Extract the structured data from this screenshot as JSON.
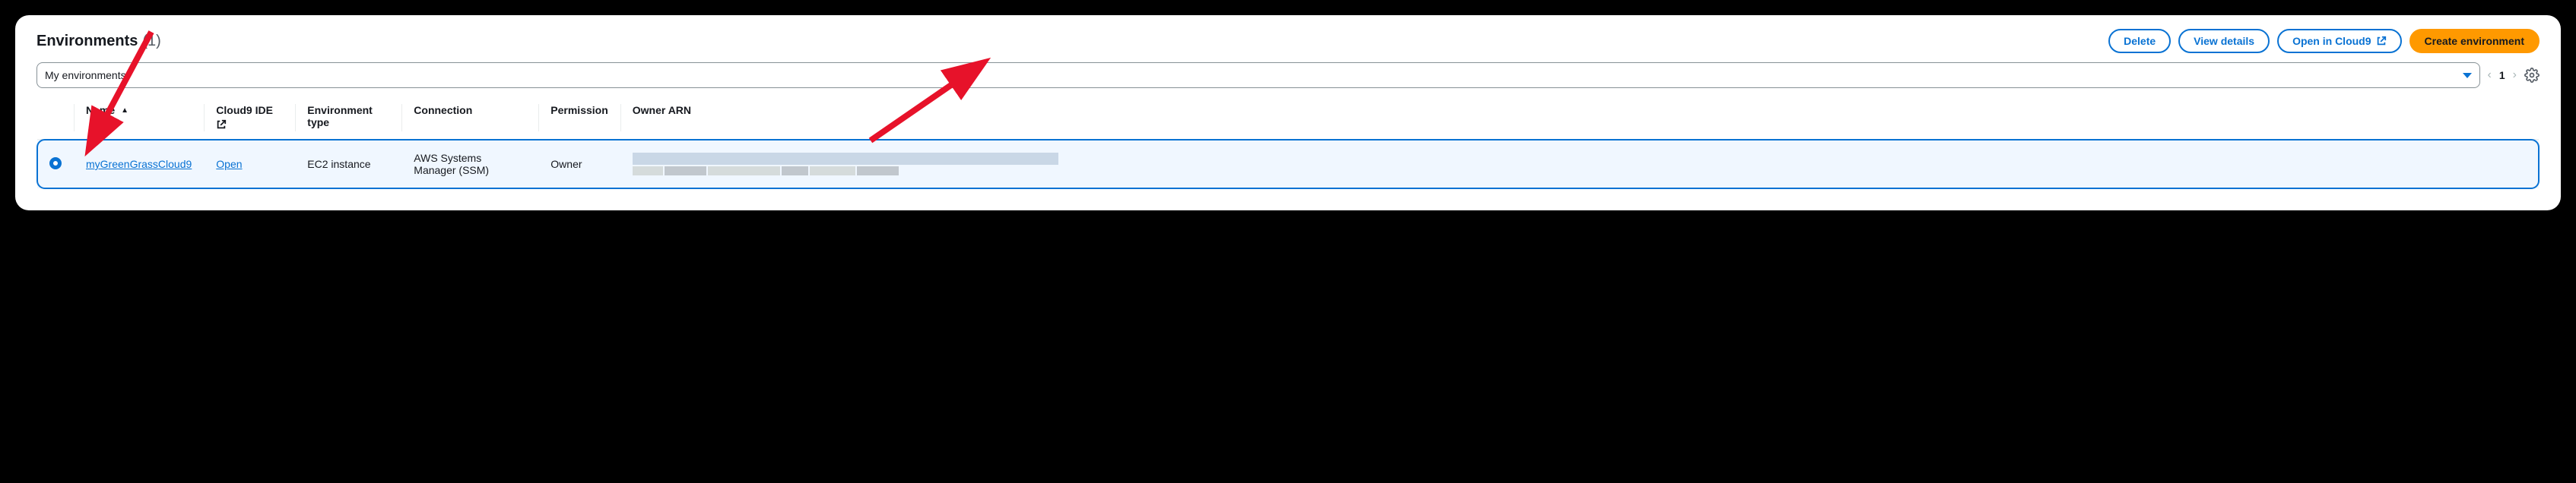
{
  "header": {
    "title": "Environments",
    "count": "(1)"
  },
  "actions": {
    "delete": "Delete",
    "view_details": "View details",
    "open_cloud9": "Open in Cloud9",
    "create": "Create environment"
  },
  "filter": {
    "label": "My environments"
  },
  "pager": {
    "page": "1"
  },
  "columns": {
    "name": "Name",
    "ide": "Cloud9 IDE",
    "type": "Environment type",
    "connection": "Connection",
    "permission": "Permission",
    "owner": "Owner ARN"
  },
  "row": {
    "name": "myGreenGrassCloud9",
    "ide_link": "Open",
    "type": "EC2 instance",
    "connection": "AWS Systems Manager (SSM)",
    "permission": "Owner"
  }
}
